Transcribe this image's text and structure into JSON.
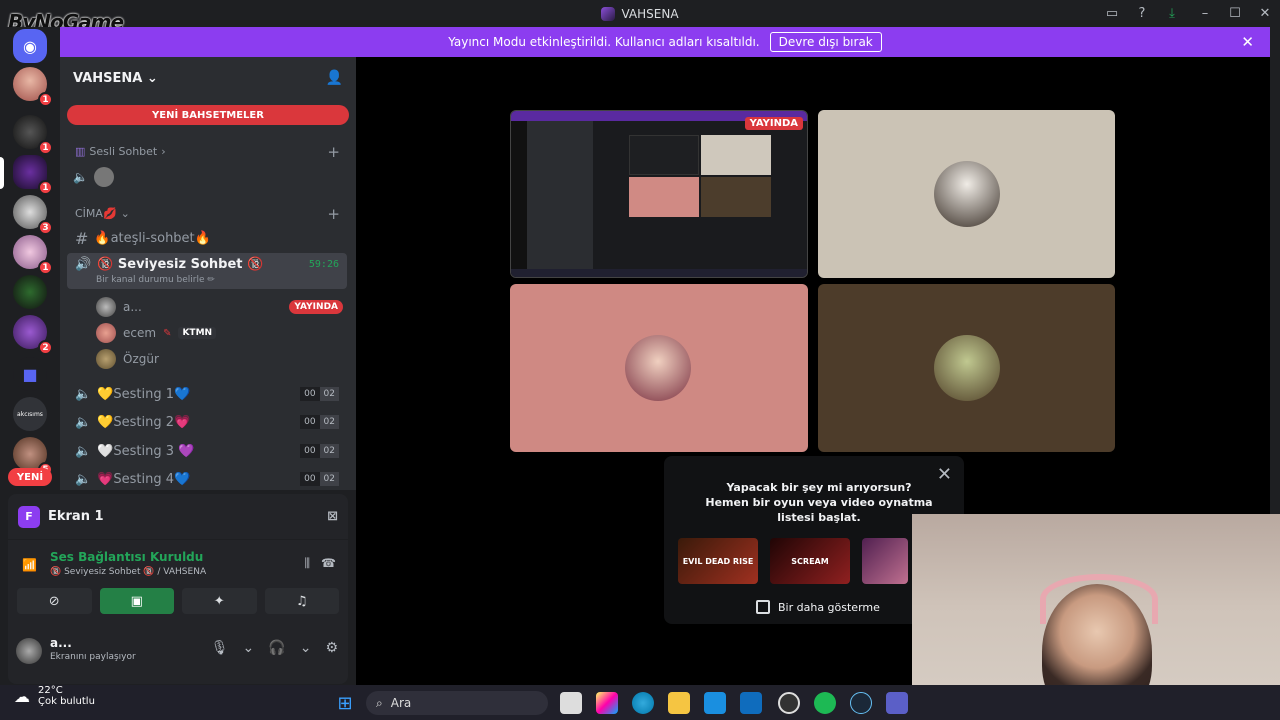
{
  "window": {
    "title": "VAHSENA",
    "watermark": "ByNoGame"
  },
  "banner": {
    "text": "Yayıncı Modu etkinleştirildi. Kullanıcı adları kısaltıldı.",
    "button": "Devre dışı bırak"
  },
  "guilds": {
    "badges": [
      "1",
      "1",
      "1",
      "3",
      "1",
      "2",
      "5"
    ],
    "label_ai": "akcısıms",
    "new_label": "YENİ"
  },
  "server": {
    "name": "VAHSENA",
    "new_mentions": "YENİ BAHSETMELER",
    "categories": {
      "sesli": "Sesli Sohbet",
      "cima": "CİMA💋"
    },
    "channels": {
      "atesli": "🔥ateşli-sohbet🔥",
      "seviyesiz": "🔞 Seviyesiz Sohbet 🔞",
      "seviyesiz_time": "59:26",
      "seviyesiz_status": "Bir kanal durumu belirle ✏",
      "sesting1": "💛Sesting 1💙",
      "sesting2": "💛Sesting 2💗",
      "sesting3": "🤍Sesting 3 💜",
      "sesting4": "💗Sesting 4💙",
      "limit_a": "00",
      "limit_b": "02"
    },
    "members": [
      {
        "name": "a...",
        "live": "YAYINDA"
      },
      {
        "name": "ecem",
        "tag": "KTMN"
      },
      {
        "name": "Özgür"
      }
    ]
  },
  "panel": {
    "screen_title": "Ekran 1",
    "screen_icon_letter": "F",
    "connection": "Ses Bağlantısı Kuruldu",
    "connection_sub": "🔞 Seviyesiz Sohbet 🔞 / VAHSENA"
  },
  "user": {
    "name": "a...",
    "status": "Ekranını paylaşıyor"
  },
  "stage": {
    "live_badge": "YAYINDA"
  },
  "popup": {
    "line1": "Yapacak bir şey mi arıyorsun?",
    "line2": "Hemen bir oyun veya video oynatma listesi başlat.",
    "thumb1": "EVIL DEAD RISE",
    "thumb2": "SCREAM",
    "checkbox": "Bir daha gösterme"
  },
  "taskbar": {
    "temp": "22°C",
    "weather": "Çok bulutlu",
    "search_placeholder": "Ara"
  },
  "colors": {
    "accent": "#8c3df0",
    "live": "#da373c",
    "connected": "#23a559"
  }
}
